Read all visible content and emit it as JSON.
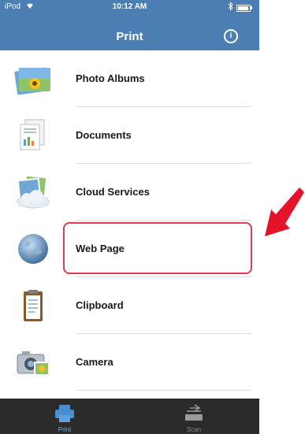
{
  "status_bar": {
    "carrier": "iPod",
    "time": "10:12 AM"
  },
  "header": {
    "title": "Print",
    "info_icon": "info-icon"
  },
  "menu": [
    {
      "label": "Photo Albums",
      "icon": "photo-albums-icon"
    },
    {
      "label": "Documents",
      "icon": "documents-icon"
    },
    {
      "label": "Cloud Services",
      "icon": "cloud-services-icon"
    },
    {
      "label": "Web Page",
      "icon": "globe-icon"
    },
    {
      "label": "Clipboard",
      "icon": "clipboard-icon"
    },
    {
      "label": "Camera",
      "icon": "camera-icon"
    }
  ],
  "tabs": [
    {
      "label": "Print",
      "icon": "printer-icon",
      "selected": true
    },
    {
      "label": "Scan",
      "icon": "scanner-icon",
      "selected": false
    }
  ],
  "colors": {
    "header": "#4b7fb4",
    "highlight": "#e23b4e",
    "tabbar": "#2b2b2b",
    "tab_active": "#7aa9d6"
  }
}
